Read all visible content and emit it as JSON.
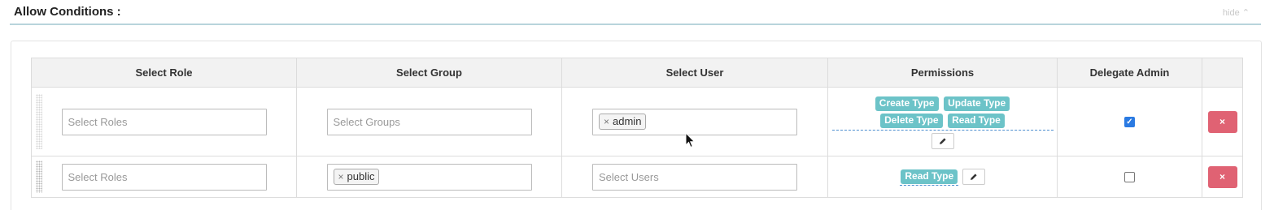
{
  "section": {
    "title": "Allow Conditions :",
    "hide_label": "hide ⌃"
  },
  "table": {
    "headers": [
      "Select Role",
      "Select Group",
      "Select User",
      "Permissions",
      "Delegate Admin",
      ""
    ],
    "rows": [
      {
        "role_placeholder": "Select Roles",
        "group_placeholder": "Select Groups",
        "user_chip": "admin",
        "permissions": [
          "Create Type",
          "Update Type",
          "Delete Type",
          "Read Type"
        ],
        "delegate_admin": true,
        "delete_icon": "×"
      },
      {
        "role_placeholder": "Select Roles",
        "group_chip": "public",
        "user_placeholder": "Select Users",
        "permissions": [
          "Read Type"
        ],
        "delegate_admin": false,
        "delete_icon": "×"
      }
    ]
  },
  "icons": {
    "remove_chip": "×",
    "edit": "pencil-icon",
    "check": "✓"
  },
  "colors": {
    "tag": "#6cc3c8",
    "delete": "#e06273",
    "checkbox": "#2a7ae2"
  }
}
